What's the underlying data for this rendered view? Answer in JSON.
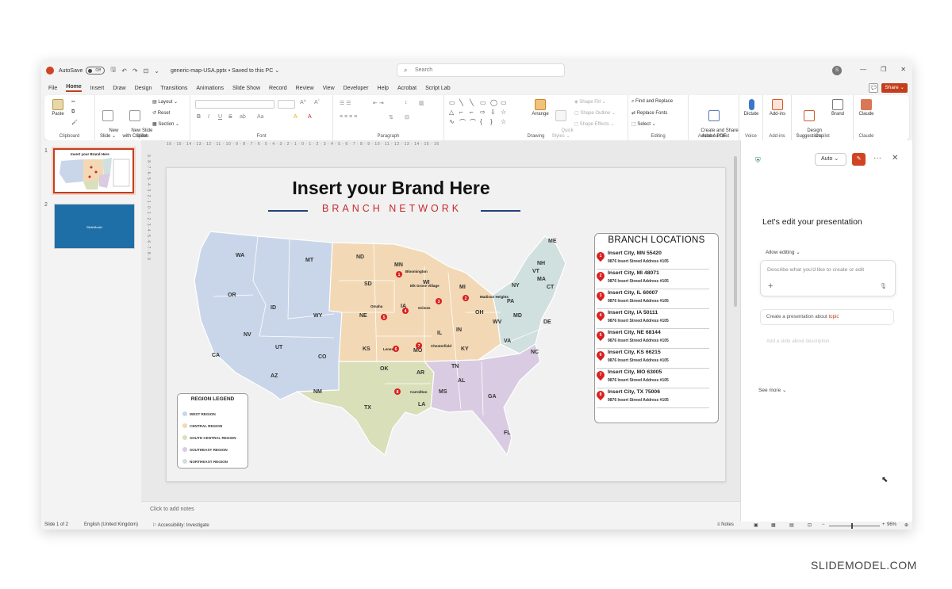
{
  "window": {
    "autosave_label": "AutoSave",
    "autosave_state": "Off",
    "doc_title": "generic-map-USA.pptx  •  Saved to this PC ⌄",
    "search_placeholder": "Search",
    "user_initial": "S"
  },
  "menu": {
    "tabs": [
      "File",
      "Home",
      "Insert",
      "Draw",
      "Design",
      "Transitions",
      "Animations",
      "Slide Show",
      "Record",
      "Review",
      "View",
      "Developer",
      "Help",
      "Acrobat",
      "Script Lab"
    ],
    "share_label": "Share"
  },
  "ribbon": {
    "clipboard": {
      "label": "Clipboard",
      "paste": "Paste"
    },
    "slides": {
      "label": "Slides",
      "new_slide": "New\nSlide ⌄",
      "new_slide_copilot": "New Slide\nwith Copilot",
      "layout": "Layout ⌄",
      "reset": "Reset",
      "section": "Section ⌄"
    },
    "font": {
      "label": "Font",
      "bold": "B",
      "italic": "I",
      "underline": "U",
      "strike": "S",
      "spacing": "ab",
      "case": "Aa",
      "highlight": "A",
      "color": "A"
    },
    "paragraph": {
      "label": "Paragraph"
    },
    "drawing": {
      "label": "Drawing",
      "arrange": "Arrange",
      "quick_styles": "Quick\nStyles ⌄",
      "shape_fill": "Shape Fill ⌄",
      "shape_outline": "Shape Outline ⌄",
      "shape_effects": "Shape Effects ⌄"
    },
    "editing": {
      "label": "Editing",
      "find": "Find and Replace",
      "replace_fonts": "Replace Fonts",
      "select": "Select ⌄"
    },
    "adobe": {
      "label": "Adobe Acrobat",
      "create_share": "Create and Share\nAdobe PDF"
    },
    "voice": {
      "label": "Voice",
      "dictate": "Dictate"
    },
    "addins": {
      "label": "Add-ins",
      "addins_btn": "Add-ins"
    },
    "copilot": {
      "label": "Copilot",
      "design_suggestions": "Design\nSuggestions",
      "brand": "Brand"
    },
    "claude": {
      "label": "Claude",
      "claude_btn": "Claude"
    }
  },
  "thumbnails": {
    "items": [
      {
        "num": "1",
        "mini_title": "Insert your Brand Here"
      },
      {
        "num": "2",
        "mini_title": "SlideModel"
      }
    ]
  },
  "ruler": {
    "horizontal": "16 · 15 · 14 · 13 · 12 · 11 · 10 · 9 · 8 · 7 · 6 · 5 · 4 · 3 · 2 · 1 · 0 · 1 · 2 · 3 · 4 · 5 · 6 · 7 · 8 · 9 · 10 · 11 · 12 · 13 · 14 · 15 · 16",
    "vertical": "9 · 8 · 7 · 6 · 5 · 4 · 3 · 2 · 1 · 0 · 1 · 2 · 3 · 4 · 5 · 6 · 7 · 8 · 9"
  },
  "slide": {
    "title": "Insert your Brand Here",
    "subtitle": "BRANCH NETWORK",
    "accent_red": "#c62b2b",
    "accent_blue": "#23407c",
    "states": {
      "west": [
        "WA",
        "OR",
        "CA",
        "MT",
        "ID",
        "NV",
        "WY",
        "UT",
        "CO",
        "AZ",
        "NM"
      ],
      "central": [
        "ND",
        "MN",
        "SD",
        "NE",
        "KS",
        "IA",
        "MO",
        "WI",
        "IL",
        "MI",
        "IN",
        "OH",
        "KY"
      ],
      "south_central": [
        "OK",
        "TX",
        "AR",
        "LA"
      ],
      "southeast": [
        "TN",
        "MS",
        "AL",
        "GA",
        "FL",
        "NC"
      ],
      "northeast": [
        "ME",
        "NH",
        "VT",
        "MA",
        "CT",
        "NY",
        "PA",
        "WV",
        "VA",
        "MD",
        "DE"
      ]
    },
    "city_labels": [
      "Bloomington",
      "Elk Grove Village",
      "Madison Heights",
      "Omaha",
      "Grimes",
      "Lenexa",
      "Chesterfield",
      "Carrollton"
    ],
    "legend": {
      "title": "REGION LEGEND",
      "items": [
        {
          "label": "WEST REGION",
          "color": "#c9d6ea"
        },
        {
          "label": "CENTRAL REGION",
          "color": "#f2d8b4"
        },
        {
          "label": "SOUTH CENTRAL REGION",
          "color": "#d9dfb9"
        },
        {
          "label": "SOUTHEAST REGION",
          "color": "#d9cbe2"
        },
        {
          "label": "NORTHEAST REGION",
          "color": "#cfe0df"
        }
      ]
    },
    "branches": {
      "title": "BRANCH LOCATIONS",
      "items": [
        {
          "num": "1",
          "city": "Insert City, MN 55420",
          "addr": "9876 Insert Streed Address #105"
        },
        {
          "num": "2",
          "city": "Insert City, MI 48071",
          "addr": "9876 Insert Streed Address #105"
        },
        {
          "num": "3",
          "city": "Insert City, IL 60007",
          "addr": "9876 Insert Streed Address #105"
        },
        {
          "num": "4",
          "city": "Insert City, IA 50111",
          "addr": "9876 Insert Streed Address #105"
        },
        {
          "num": "5",
          "city": "Insert City, NE 68144",
          "addr": "9876 Insert Streed Address #105"
        },
        {
          "num": "6",
          "city": "Insert City, KS 66215",
          "addr": "9876 Insert Streed Address #105"
        },
        {
          "num": "7",
          "city": "Insert City, MO 63005",
          "addr": "9876 Insert Streed Address #105"
        },
        {
          "num": "8",
          "city": "Insert City, TX 75006",
          "addr": "9876 Insert Streed Address #105"
        }
      ]
    }
  },
  "notes": {
    "placeholder": "Click to add notes"
  },
  "copilot": {
    "mode": "Auto ⌄",
    "heading": "Let's edit your presentation",
    "allow_editing": "Allow editing ⌄",
    "input_placeholder": "Describe what you'd like to create or edit",
    "suggestion_prefix": "Create a presentation about ",
    "suggestion_topic": "topic",
    "suggestion2": "Add a slide about description",
    "see_more": "See more ⌄"
  },
  "status": {
    "slide_counter": "Slide 1 of 2",
    "language": "English (United Kingdom)",
    "accessibility": "Accessibility: Investigate",
    "notes": "Notes",
    "zoom": "96%"
  },
  "watermark": "SLIDEMODEL.COM"
}
